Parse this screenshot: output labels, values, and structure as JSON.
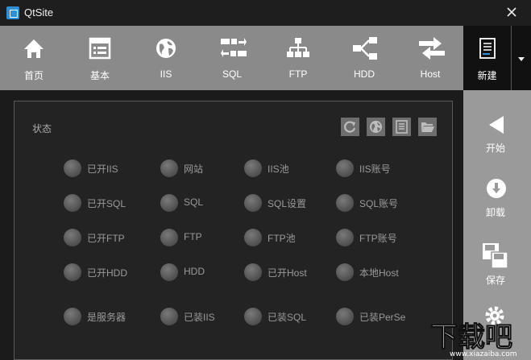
{
  "window": {
    "title": "QtSite"
  },
  "toolbar": {
    "items": [
      {
        "label": "首页",
        "icon": "home-icon"
      },
      {
        "label": "基本",
        "icon": "form-icon"
      },
      {
        "label": "IIS",
        "icon": "globe-icon"
      },
      {
        "label": "SQL",
        "icon": "transfer-icon"
      },
      {
        "label": "FTP",
        "icon": "network-icon"
      },
      {
        "label": "HDD",
        "icon": "share-nodes-icon"
      },
      {
        "label": "Host",
        "icon": "swap-arrows-icon"
      }
    ],
    "new_label": "新建"
  },
  "status_panel": {
    "title": "状态",
    "tools": [
      "refresh-icon",
      "globe-icon",
      "list-icon",
      "folder-open-icon"
    ],
    "rows": [
      [
        "已开IIS",
        "网站",
        "IIS池",
        "IIS账号"
      ],
      [
        "已开SQL",
        "SQL",
        "SQL设置",
        "SQL账号"
      ],
      [
        "已开FTP",
        "FTP",
        "FTP池",
        "FTP账号"
      ],
      [
        "已开HDD",
        "HDD",
        "已开Host",
        "本地Host"
      ],
      [
        "是服务器",
        "已装IIS",
        "已装SQL",
        "已装PerSe"
      ]
    ]
  },
  "sidebar": {
    "items": [
      {
        "label": "开始",
        "icon": "play-back-icon"
      },
      {
        "label": "卸载",
        "icon": "download-icon"
      },
      {
        "label": "保存",
        "icon": "save-icon"
      }
    ]
  },
  "colors": {
    "toolbar": "#8a8a8a",
    "sidebar": "#9a9a9a",
    "background": "#1b1b1b",
    "accent": "#2f8fd6"
  }
}
